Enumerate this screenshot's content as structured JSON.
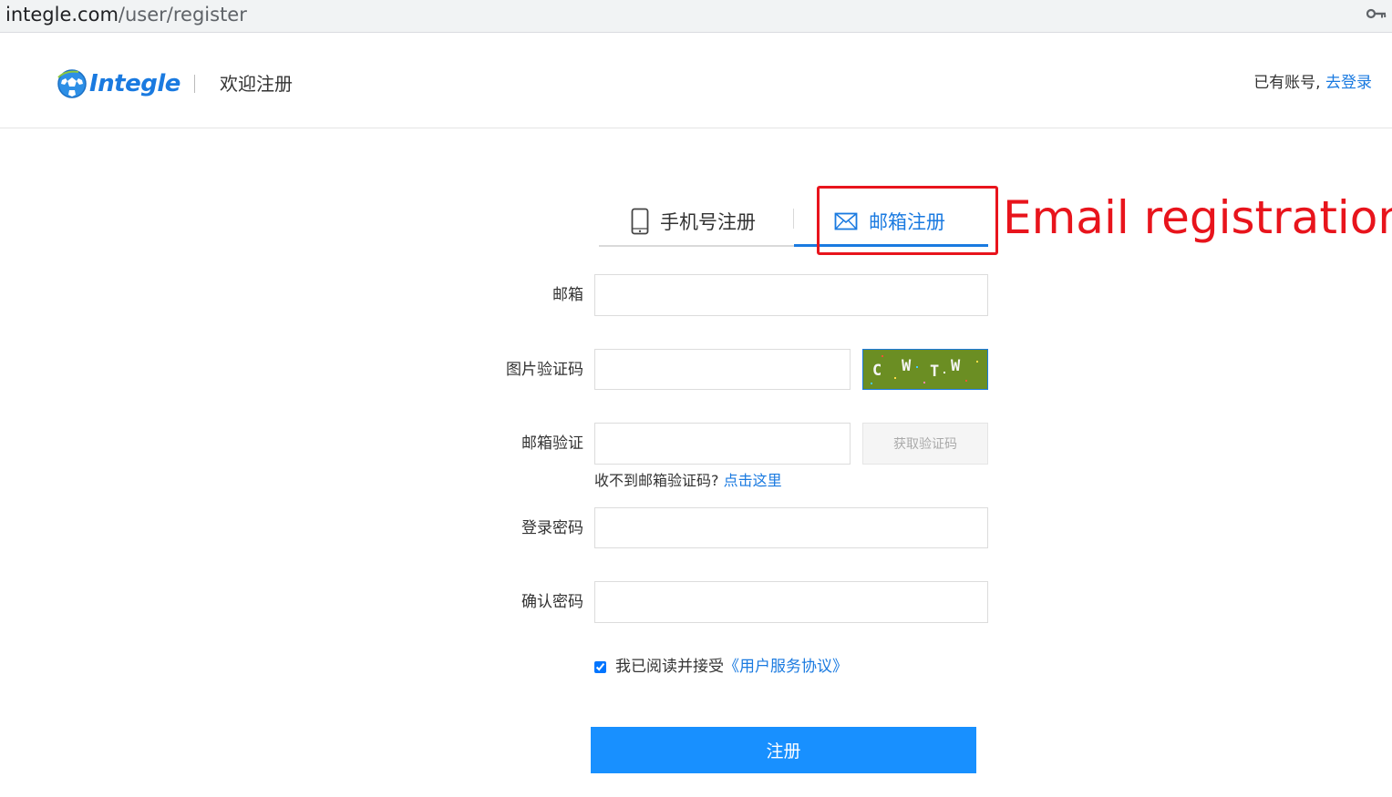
{
  "browser": {
    "url_host": "integle.com",
    "url_path": "/user/register",
    "key_icon": "key-icon"
  },
  "header": {
    "logo_text": "Integle",
    "title": "欢迎注册",
    "have_account": "已有账号, ",
    "login_link": "去登录"
  },
  "tabs": [
    {
      "label": "手机号注册",
      "icon": "phone-icon",
      "active": false
    },
    {
      "label": "邮箱注册",
      "icon": "mail-icon",
      "active": true
    }
  ],
  "annotation": {
    "text": "Email registration",
    "color": "#e8141c"
  },
  "form": {
    "email_label": "邮箱",
    "email_value": "",
    "captcha_label": "图片验证码",
    "captcha_value": "",
    "captcha_chars": [
      "C",
      "W",
      "T",
      "W"
    ],
    "email_verify_label": "邮箱验证",
    "email_verify_value": "",
    "get_code_button": "获取验证码",
    "hint_text": "收不到邮箱验证码?",
    "hint_link": "点击这里",
    "password_label": "登录密码",
    "password_value": "",
    "confirm_label": "确认密码",
    "confirm_value": "",
    "agree_text": "我已阅读并接受",
    "agree_link": "《用户服务协议》",
    "agree_checked": true,
    "submit_label": "注册"
  },
  "colors": {
    "brand_blue": "#1a7ae0",
    "submit_blue": "#1890ff",
    "captcha_bg": "#6b8e23"
  }
}
